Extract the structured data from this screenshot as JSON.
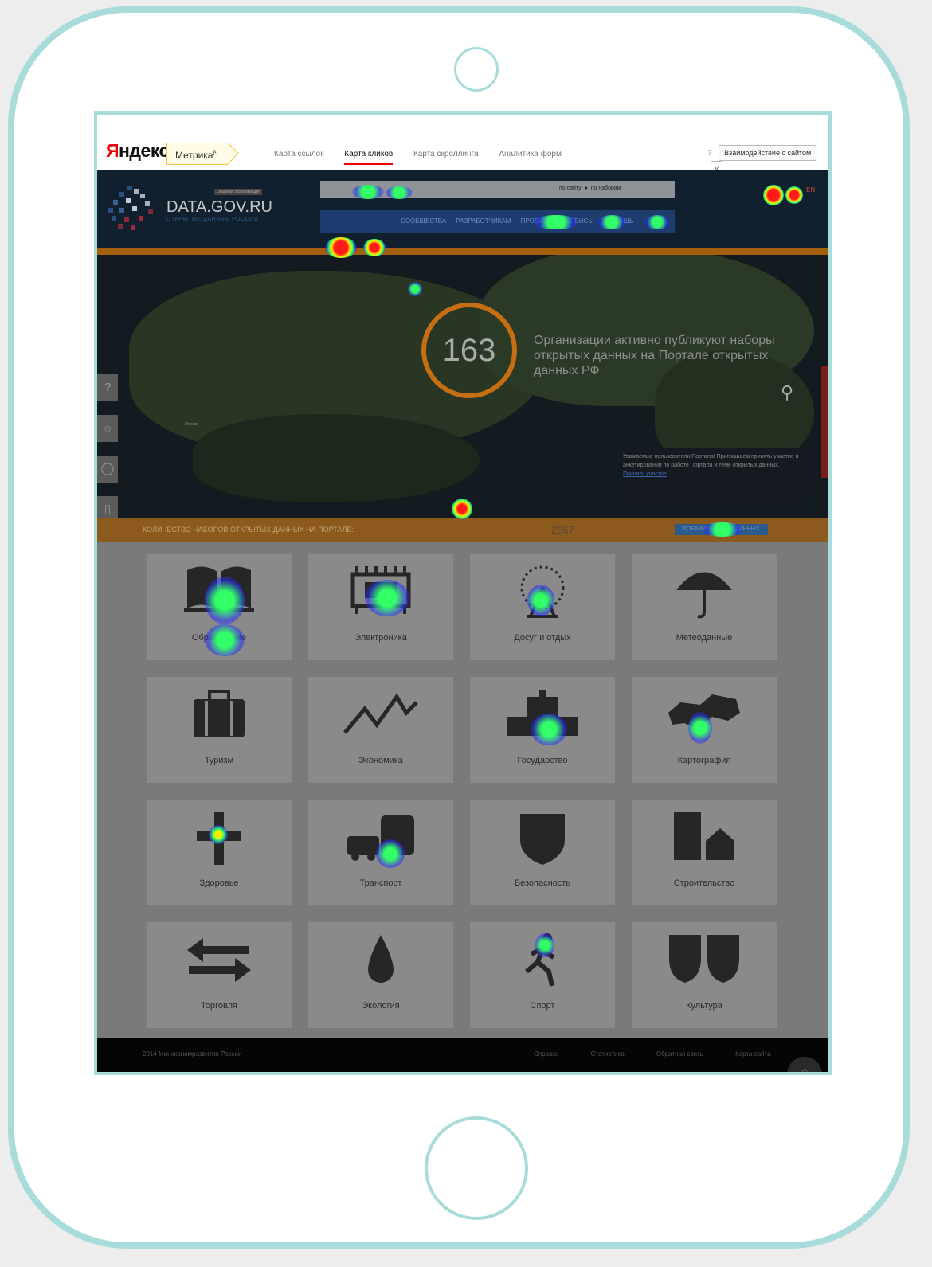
{
  "metrika": {
    "logo_red": "Я",
    "logo_rest": "ндекс",
    "badge": "Метрика",
    "badge_sup": "β",
    "tabs": [
      {
        "label": "Карта ссылок"
      },
      {
        "label": "Карта кликов"
      },
      {
        "label": "Карта скроллинга"
      },
      {
        "label": "Аналитика форм"
      }
    ],
    "help": "?",
    "mode_select": "Взаимодействие с сайтом",
    "mode_arrow": "˅"
  },
  "portal": {
    "title": "DATA.GOV.RU",
    "subtitle": "ОТКРЫТЫЕ ДАННЫЕ РОССИИ",
    "tag": "Опытная эксплуатация",
    "search_radio": [
      "по сайту",
      "по наборам"
    ],
    "nav": [
      "СООБЩЕСТВА",
      "РАЗРАБОТЧИКАМ",
      "ПРОЕКТЫ",
      "СЕРВИСЫ",
      "ПОМОЩЬ"
    ],
    "lang": "EN",
    "count_big": "163",
    "map_caption": "Организации активно публикуют наборы открытых данных на Портале открытых данных РФ",
    "city": "Москва",
    "notice_text": "Уважаемые пользователи Портала! Приглашаем принять участие в анкетировании по работе Портала и теме открытых данных.",
    "notice_link": "Принять участие",
    "count_label": "КОЛИЧЕСТВО НАБОРОВ ОТКРЫТЫХ ДАННЫХ НА ПОРТАЛЕ:",
    "count_value": "2667",
    "add_button": "ДОБАВИТЬ НАБОР ДАННЫХ",
    "categories": [
      "Образование",
      "Электроника",
      "Досуг и отдых",
      "Метеоданные",
      "Туризм",
      "Экономика",
      "Государство",
      "Картография",
      "Здоровье",
      "Транспорт",
      "Безопасность",
      "Строительство",
      "Торговля",
      "Экология",
      "Спорт",
      "Культура"
    ],
    "footer_copy": "2014 Минэкономразвития России",
    "footer_links": [
      "Справка",
      "Статистика",
      "Обратная связь",
      "Карта сайта"
    ]
  },
  "colors": {
    "frame": "#a7dcdb",
    "accent_red": "#ee0000",
    "heat_low": "#2a2aff",
    "heat_mid": "#33ff66",
    "heat_high": "#ff1a1a"
  }
}
